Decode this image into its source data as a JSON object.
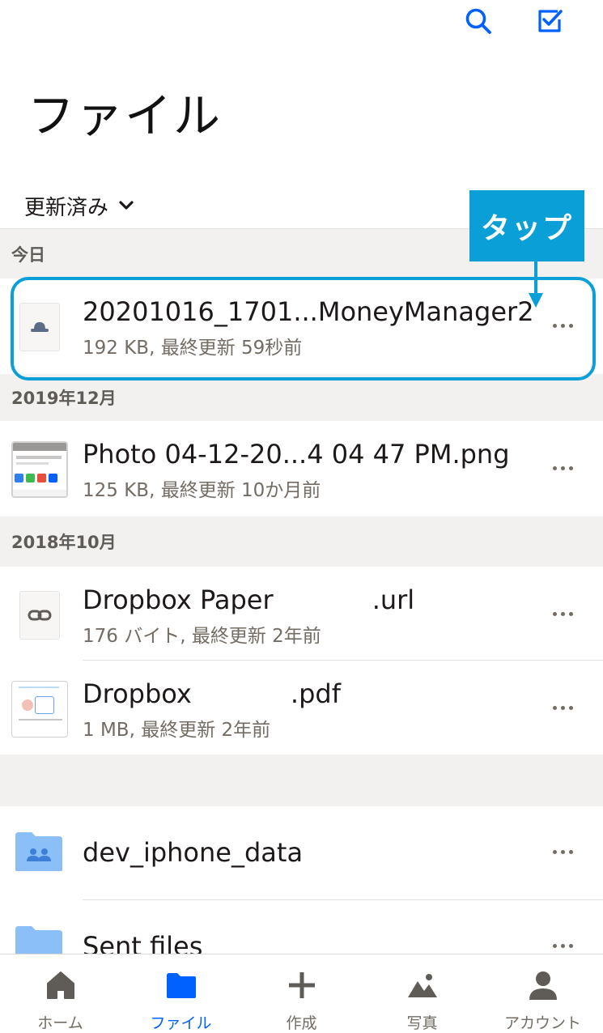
{
  "header": {
    "search_icon": "search-icon",
    "select_icon": "checkbox-select-icon",
    "title": "ファイル"
  },
  "sort": {
    "label": "更新済み",
    "icon": "chevron-down-icon"
  },
  "sections": {
    "today": "今日",
    "dec2019": "2019年12月",
    "oct2018": "2018年10月"
  },
  "files": [
    {
      "name": "20201016_1701...MoneyManager2",
      "meta": "192 KB, 最終更新 59秒前",
      "icon": "generic-file-icon"
    },
    {
      "name": "Photo 04-12-20...4 04 47 PM.png",
      "meta": "125 KB, 最終更新 10か月前",
      "icon": "image-thumbnail"
    },
    {
      "name": "Dropbox Paper            .url",
      "meta": "176 バイト, 最終更新 2年前",
      "icon": "link-icon"
    },
    {
      "name": "Dropbox            .pdf",
      "meta": "1 MB, 最終更新 2年前",
      "icon": "pdf-thumbnail"
    }
  ],
  "folders": [
    {
      "name": "dev_iphone_data",
      "icon": "shared-folder-icon"
    },
    {
      "name": "Sent files",
      "icon": "folder-icon"
    }
  ],
  "annotation": {
    "label": "タップ",
    "color": "#0b9fd8"
  },
  "tabs": [
    {
      "label": "ホーム",
      "icon": "home-icon",
      "active": false
    },
    {
      "label": "ファイル",
      "icon": "folder-icon",
      "active": true
    },
    {
      "label": "作成",
      "icon": "plus-icon",
      "active": false
    },
    {
      "label": "写真",
      "icon": "photos-icon",
      "active": false
    },
    {
      "label": "アカウント",
      "icon": "account-icon",
      "active": false
    }
  ],
  "colors": {
    "accent": "#0061fe",
    "folder": "#8ac0f7",
    "secondary_text": "#736c64"
  }
}
